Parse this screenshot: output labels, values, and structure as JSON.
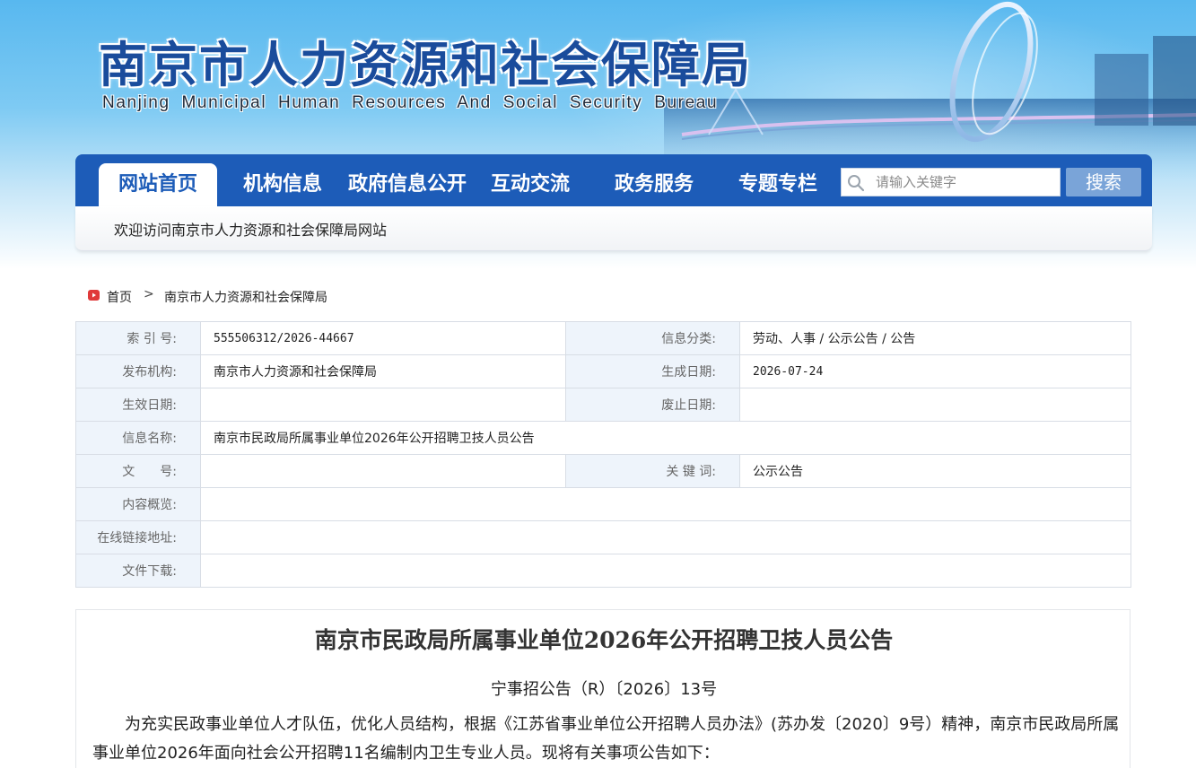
{
  "banner": {
    "title": "南京市人力资源和社会保障局",
    "subtitle": "Nanjing Municipal Human Resources And Social Security Bureau"
  },
  "nav": {
    "items": [
      {
        "label": "网站首页",
        "active": true
      },
      {
        "label": "机构信息"
      },
      {
        "label": "政府信息公开"
      },
      {
        "label": "互动交流"
      },
      {
        "label": "政务服务"
      },
      {
        "label": "专题专栏"
      }
    ],
    "search": {
      "placeholder": "请输入关键字",
      "value": "",
      "icon": "search-icon"
    },
    "search_button": "搜索"
  },
  "welcome": "欢迎访问南京市人力资源和社会保障局网站",
  "breadcrumb": {
    "home": "首页",
    "separator": ">",
    "current": "南京市人力资源和社会保障局"
  },
  "info": {
    "index_no_label": "索 引 号:",
    "index_no": "555506312/2026-44667",
    "category_label": "信息分类:",
    "category": "劳动、人事 / 公示公告 / 公告",
    "publisher_label": "发布机构:",
    "publisher": "南京市人力资源和社会保障局",
    "created_label": "生成日期:",
    "created": "2026-07-24",
    "effective_label": "生效日期:",
    "effective": "",
    "expire_label": "废止日期:",
    "expire": "",
    "name_label": "信息名称:",
    "name": "南京市民政局所属事业单位2026年公开招聘卫技人员公告",
    "doc_no_label": "文　　号:",
    "doc_no": "",
    "keywords_label": "关 键 词:",
    "keywords": "公示公告",
    "summary_label": "内容概览:",
    "summary": "",
    "link_label": "在线链接地址:",
    "link": "",
    "download_label": "文件下载:",
    "download": ""
  },
  "article": {
    "title": "南京市民政局所属事业单位2026年公开招聘卫技人员公告",
    "doc_number": "宁事招公告（R）〔2026〕13号",
    "paragraph": "为充实民政事业单位人才队伍，优化人员结构，根据《江苏省事业单位公开招聘人员办法》(苏办发〔2020〕9号）精神，南京市民政局所属事业单位2026年面向社会公开招聘11名编制内卫生专业人员。现将有关事项公告如下："
  },
  "colors": {
    "nav_blue": "#1d5cb8",
    "title_blue": "#1a4c9c",
    "label_bg": "#eef4fb",
    "search_button": "#7aa4d8",
    "breadcrumb_icon": "#e03a3a"
  }
}
